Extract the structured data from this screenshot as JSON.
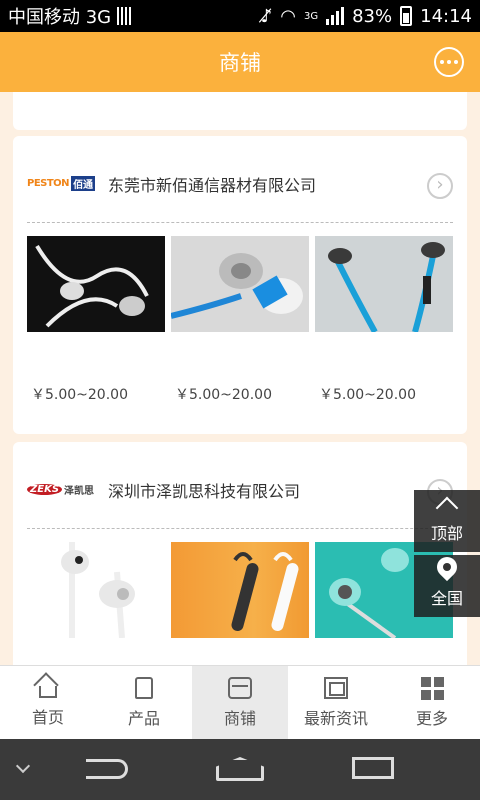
{
  "status_bar": {
    "carrier": "中国移动 3G",
    "net_type": "3G",
    "battery": "83%",
    "time": "14:14"
  },
  "header": {
    "title": "商铺",
    "message_icon": "chat-bubble-icon"
  },
  "shops": [
    {
      "logo_text_a": "PESTON",
      "logo_text_b": "佰通",
      "company": "东莞市新佰通信器材有限公司",
      "products": [
        {
          "price": "￥5.00~20.00"
        },
        {
          "price": "￥5.00~20.00"
        },
        {
          "price": "￥5.00~20.00"
        }
      ]
    },
    {
      "logo_text_a": "ZEKS",
      "logo_text_b": "泽凯思",
      "company": "深圳市泽凯思科技有限公司",
      "products": [
        {},
        {},
        {}
      ]
    }
  ],
  "float": {
    "top_label": "顶部",
    "all_label": "全国"
  },
  "tabs": [
    {
      "label": "首页",
      "icon": "home-icon"
    },
    {
      "label": "产品",
      "icon": "shirt-icon"
    },
    {
      "label": "商铺",
      "icon": "shop-icon",
      "active": true
    },
    {
      "label": "最新资讯",
      "icon": "news-icon"
    },
    {
      "label": "更多",
      "icon": "grid-icon"
    }
  ],
  "colors": {
    "accent": "#fbb13d",
    "background": "#fdf0e2"
  }
}
